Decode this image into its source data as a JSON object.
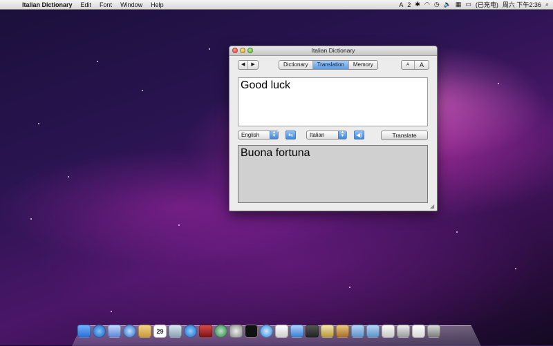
{
  "menubar": {
    "apple_icon": "apple-icon",
    "app_name": "Italian Dictionary",
    "menus": [
      "Edit",
      "Font",
      "Window",
      "Help"
    ],
    "status": {
      "input_indicator": "2",
      "battery_text": "(已充电)",
      "clock": "周六 下午2:36"
    }
  },
  "window": {
    "title": "Italian Dictionary",
    "nav": {
      "back": "◀",
      "forward": "▶"
    },
    "tabs": [
      {
        "label": "Dictionary",
        "active": false
      },
      {
        "label": "Translation",
        "active": true
      },
      {
        "label": "Memory",
        "active": false
      }
    ],
    "font_size": {
      "smaller": "A",
      "larger": "A"
    },
    "input_text": "Good luck",
    "source_language": "English",
    "target_language": "Italian",
    "translate_label": "Translate",
    "output_text": "Buona fortuna"
  },
  "dock": {
    "icons": [
      "finder-icon",
      "appstore-icon",
      "mail-icon",
      "facetime-icon",
      "notes-icon",
      "calendar-icon",
      "photos-icon",
      "itunes-icon",
      "dictionary-icon",
      "timemachine-icon",
      "preferences-icon",
      "terminal-icon",
      "safari-icon",
      "textedit-icon",
      "preview-icon",
      "disk-icon",
      "scripts-icon",
      "folder-icon",
      "folder-icon",
      "documents-icon",
      "drive-icon",
      "mail2-icon",
      "trash-icon"
    ],
    "calendar_day": "29"
  },
  "colors": {
    "accent": "#5b9ce6",
    "output_bg": "#d0d0d0"
  }
}
